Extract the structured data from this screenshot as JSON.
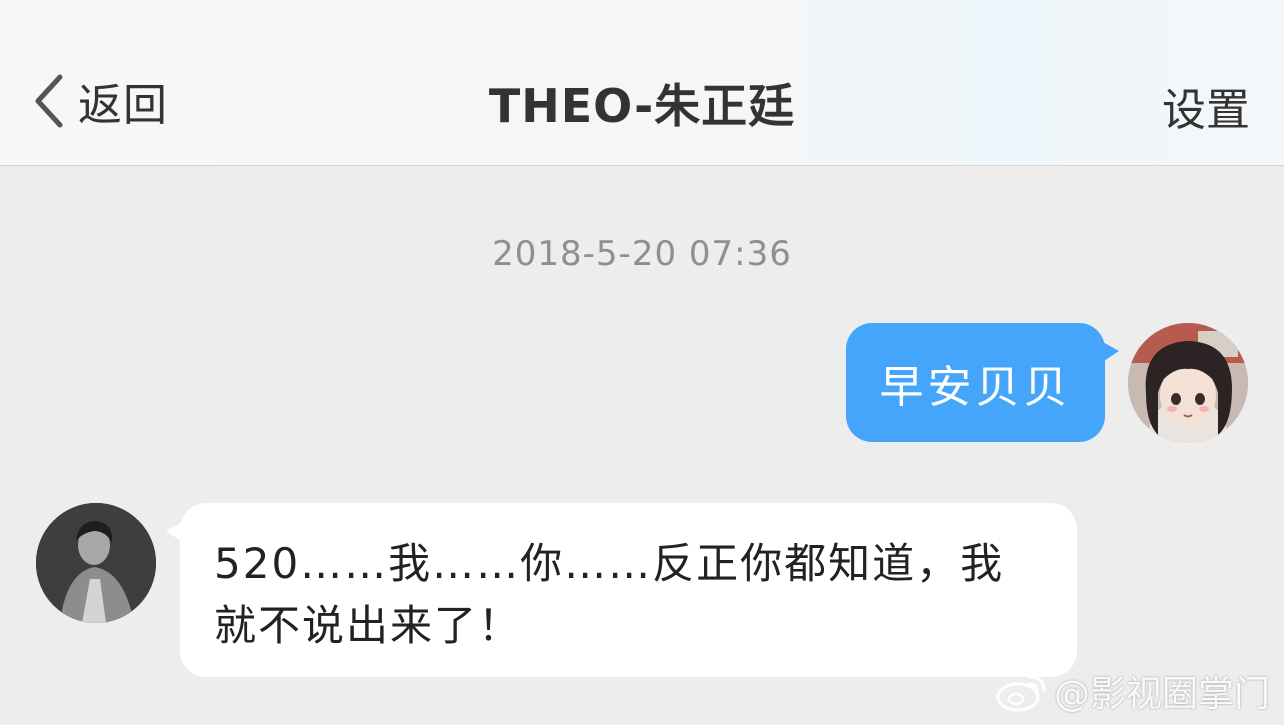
{
  "header": {
    "back_label": "返回",
    "title": "THEO-朱正廷",
    "settings_label": "设置"
  },
  "conversation": {
    "timestamp": "2018-5-20 07:36",
    "messages": [
      {
        "direction": "outgoing",
        "text": "早安贝贝",
        "bubble_color": "#45a5fb",
        "avatar": "anime-character-avatar"
      },
      {
        "direction": "incoming",
        "text": "520……我……你……反正你都知道，我就不说出来了！",
        "bubble_color": "#ffffff",
        "avatar": "bw-portrait-avatar"
      }
    ]
  },
  "watermark": {
    "icon": "weibo-icon",
    "text": "@影视圈掌门"
  },
  "colors": {
    "background": "#ededed",
    "accent_blue": "#45a5fb",
    "timestamp_gray": "#8f8f8f"
  }
}
